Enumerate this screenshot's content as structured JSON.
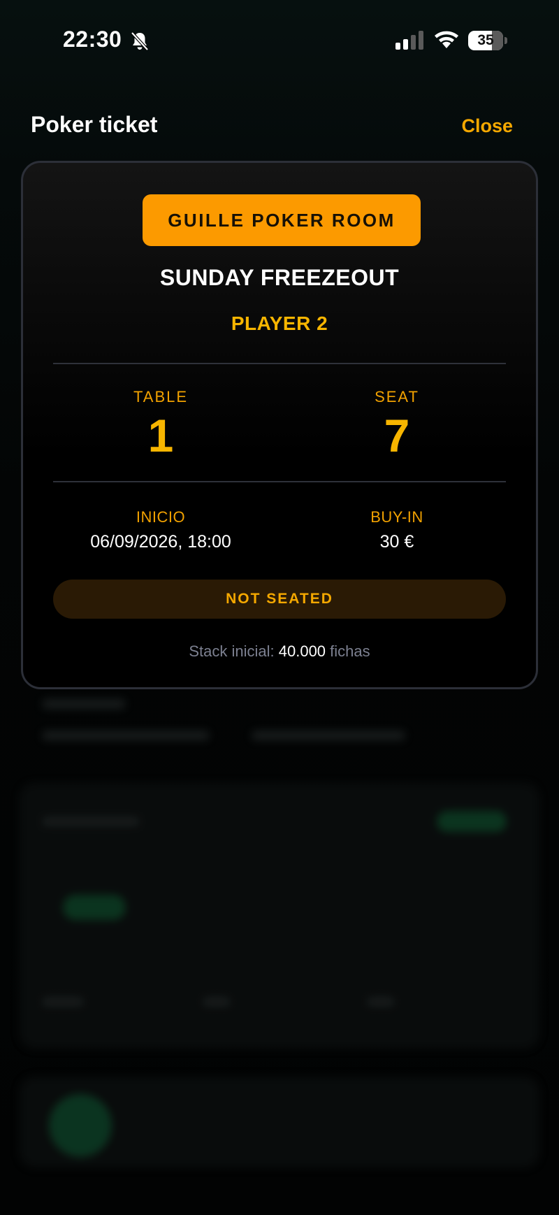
{
  "status_bar": {
    "time": "22:30",
    "battery": "35",
    "icons": [
      "bell-slash-icon",
      "cellular-signal-icon",
      "wifi-icon",
      "battery-icon"
    ]
  },
  "sheet": {
    "title": "Poker ticket",
    "close_label": "Close"
  },
  "ticket": {
    "room_name": "GUILLE POKER ROOM",
    "event_name": "SUNDAY FREEZEOUT",
    "player_name": "PLAYER 2",
    "table_label": "TABLE",
    "table_value": "1",
    "seat_label": "SEAT",
    "seat_value": "7",
    "start_label": "INICIO",
    "start_value": "06/09/2026, 18:00",
    "buyin_label": "BUY-IN",
    "buyin_value": "30 €",
    "status": "NOT SEATED",
    "stack_prefix": "Stack inicial:",
    "stack_value": "40.000",
    "stack_suffix": "fichas"
  },
  "colors": {
    "accent": "#fc9a00",
    "accent_text": "#f7b500",
    "card_border": "#2c2f38",
    "status_pill_bg": "#2a1a05"
  }
}
